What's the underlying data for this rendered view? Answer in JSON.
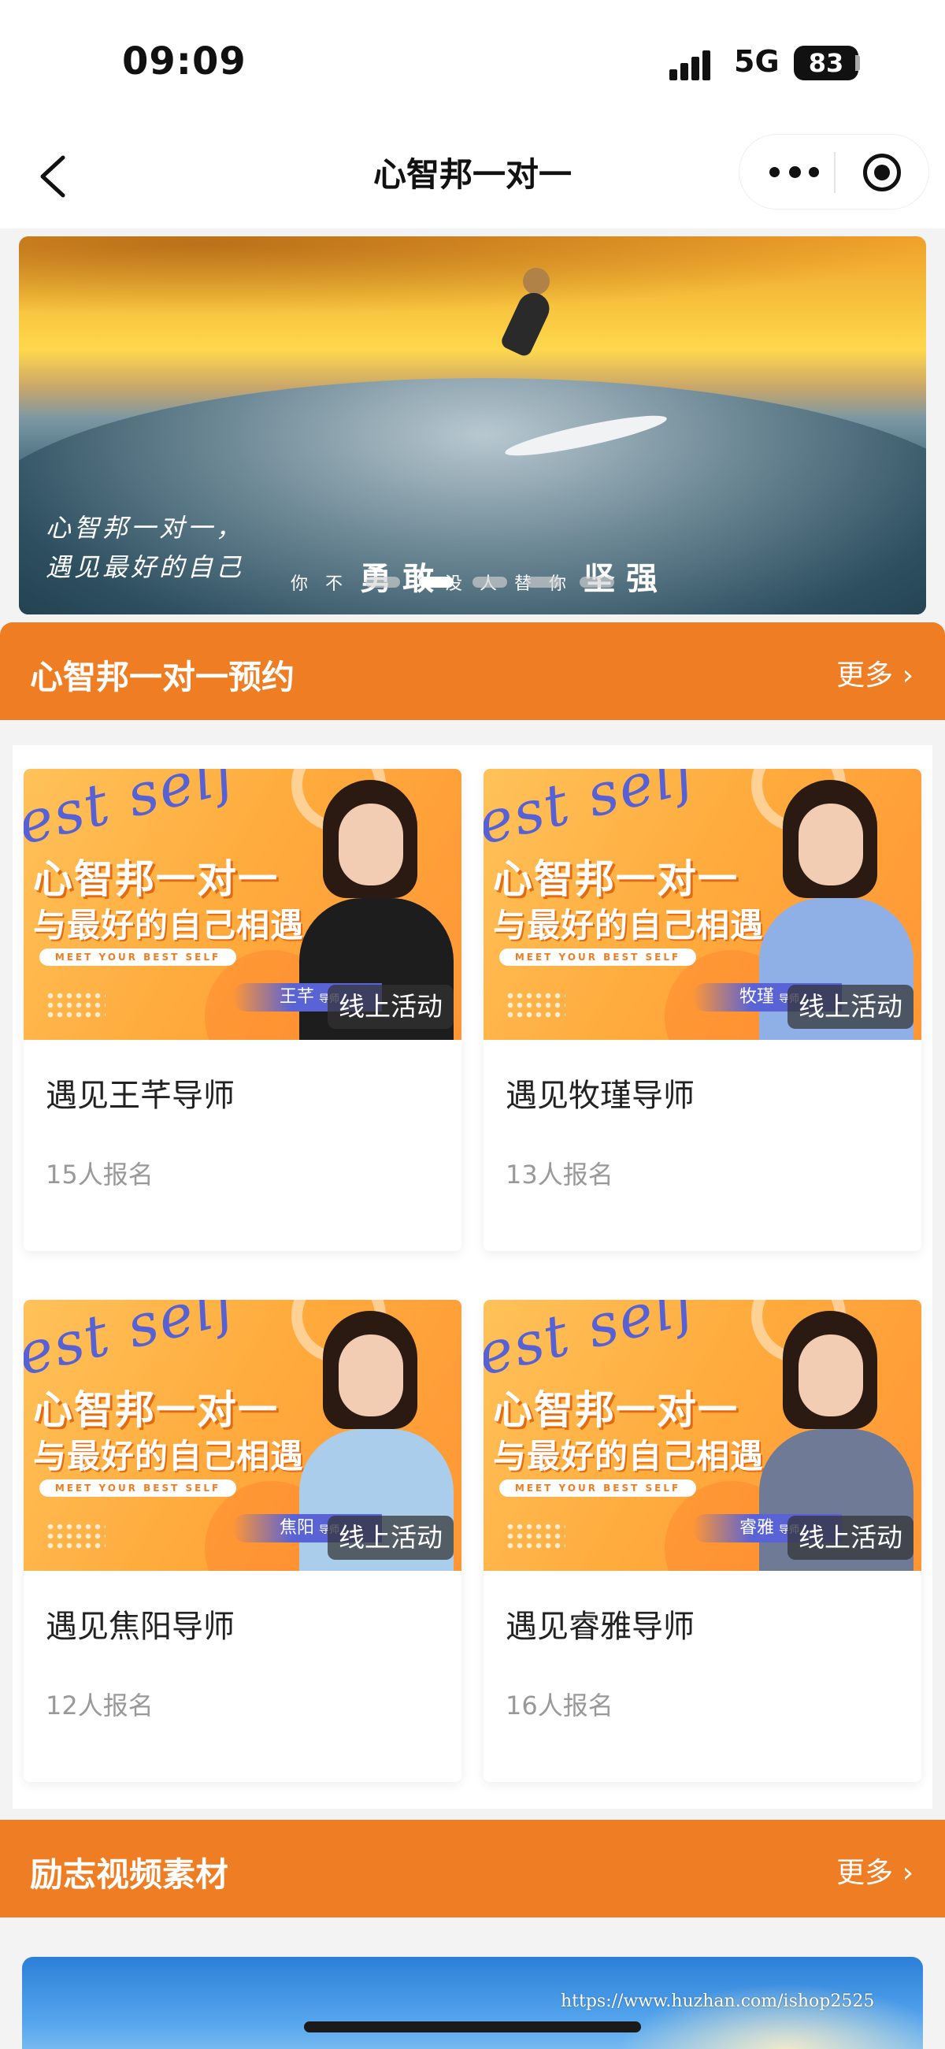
{
  "status_bar": {
    "time": "09:09",
    "network": "5G",
    "battery": "83"
  },
  "nav": {
    "title": "心智邦一对一"
  },
  "banner": {
    "line1": "心智邦一对一，",
    "line2": "遇见最好的自己",
    "slogan_small_1": "你不",
    "slogan_big_1": "勇敢",
    "slogan_small_2": "没人替你",
    "slogan_big_2": "坚强",
    "dot_count": 5,
    "active_dot": 1
  },
  "section_booking": {
    "title": "心智邦一对一预约",
    "more": "更多 ›"
  },
  "cards": [
    {
      "title": "遇见王芊导师",
      "count": "15人报名",
      "tag": "线上活动",
      "teacher": "王芊",
      "teacher_suffix": "导师",
      "headline": "心智邦一对一",
      "subline": "与最好的自己相遇",
      "eng": "MEET YOUR BEST SELF",
      "script": "est self",
      "outfit": "#1d1d1d"
    },
    {
      "title": "遇见牧瑾导师",
      "count": "13人报名",
      "tag": "线上活动",
      "teacher": "牧瑾",
      "teacher_suffix": "导师",
      "headline": "心智邦一对一",
      "subline": "与最好的自己相遇",
      "eng": "MEET YOUR BEST SELF",
      "script": "est self",
      "outfit": "#8fb0e6"
    },
    {
      "title": "遇见焦阳导师",
      "count": "12人报名",
      "tag": "线上活动",
      "teacher": "焦阳",
      "teacher_suffix": "导师",
      "headline": "心智邦一对一",
      "subline": "与最好的自己相遇",
      "eng": "MEET YOUR BEST SELF",
      "script": "est self",
      "outfit": "#a9cdea"
    },
    {
      "title": "遇见睿雅导师",
      "count": "16人报名",
      "tag": "线上活动",
      "teacher": "睿雅",
      "teacher_suffix": "导师",
      "headline": "心智邦一对一",
      "subline": "与最好的自己相遇",
      "eng": "MEET YOUR BEST SELF",
      "script": "est self",
      "outfit": "#6e7a96"
    }
  ],
  "section_video": {
    "title": "励志视频素材",
    "more": "更多 ›"
  },
  "watermark": "https://www.huzhan.com/ishop2525",
  "colors": {
    "accent": "#ef7d23",
    "background": "#f3f3f3"
  },
  "icons": [
    "back-icon",
    "more-icon",
    "target-icon"
  ]
}
